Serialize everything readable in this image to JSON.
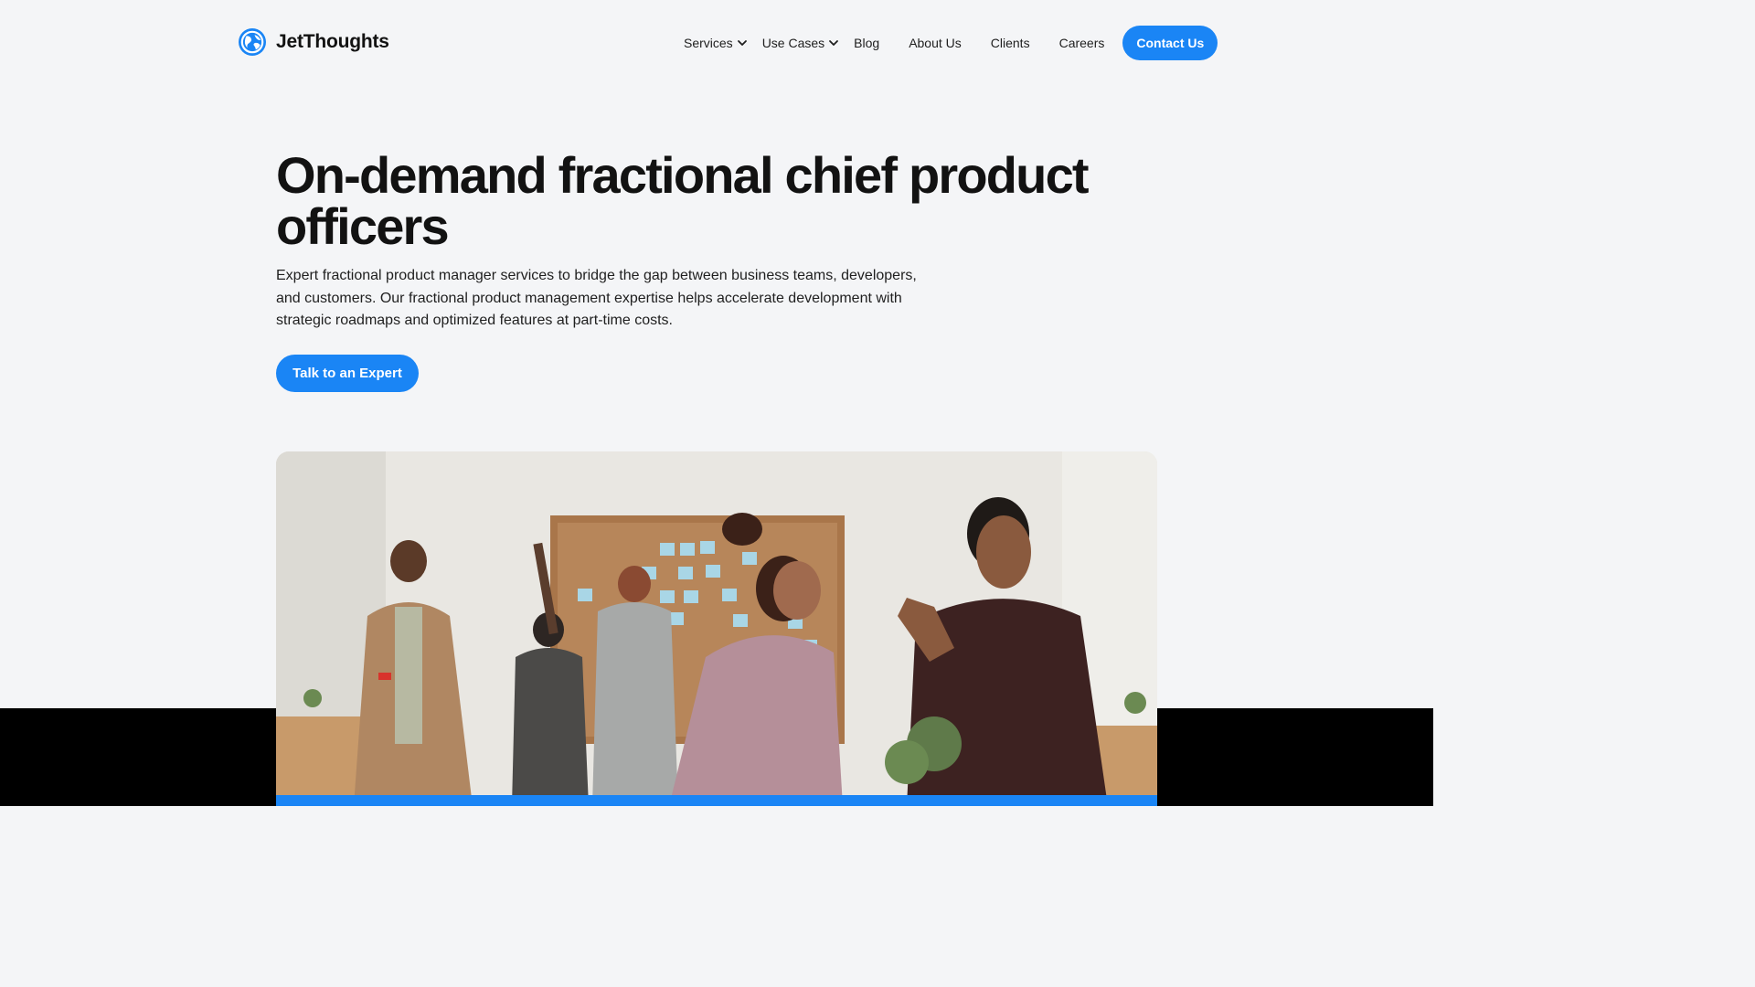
{
  "brand": {
    "name": "JetThoughts",
    "logo_icon": "globe-logo-icon",
    "accent_color": "#1a85f5"
  },
  "nav": {
    "items": [
      {
        "label": "Services",
        "has_dropdown": true
      },
      {
        "label": "Use Cases",
        "has_dropdown": true
      },
      {
        "label": "Blog",
        "has_dropdown": false
      },
      {
        "label": "About Us",
        "has_dropdown": false
      },
      {
        "label": "Clients",
        "has_dropdown": false
      },
      {
        "label": "Careers",
        "has_dropdown": false
      }
    ],
    "contact_label": "Contact Us"
  },
  "hero": {
    "title": "On-demand fractional chief product officers",
    "description": "Expert fractional product manager services to bridge the gap between business teams, developers, and customers. Our fractional product management expertise helps accelerate development with strategic roadmaps and optimized features at part-time costs.",
    "cta_label": "Talk to an Expert"
  },
  "colors": {
    "page_background": "#f4f5f7",
    "text": "#121212",
    "footer_band": "#000000"
  }
}
